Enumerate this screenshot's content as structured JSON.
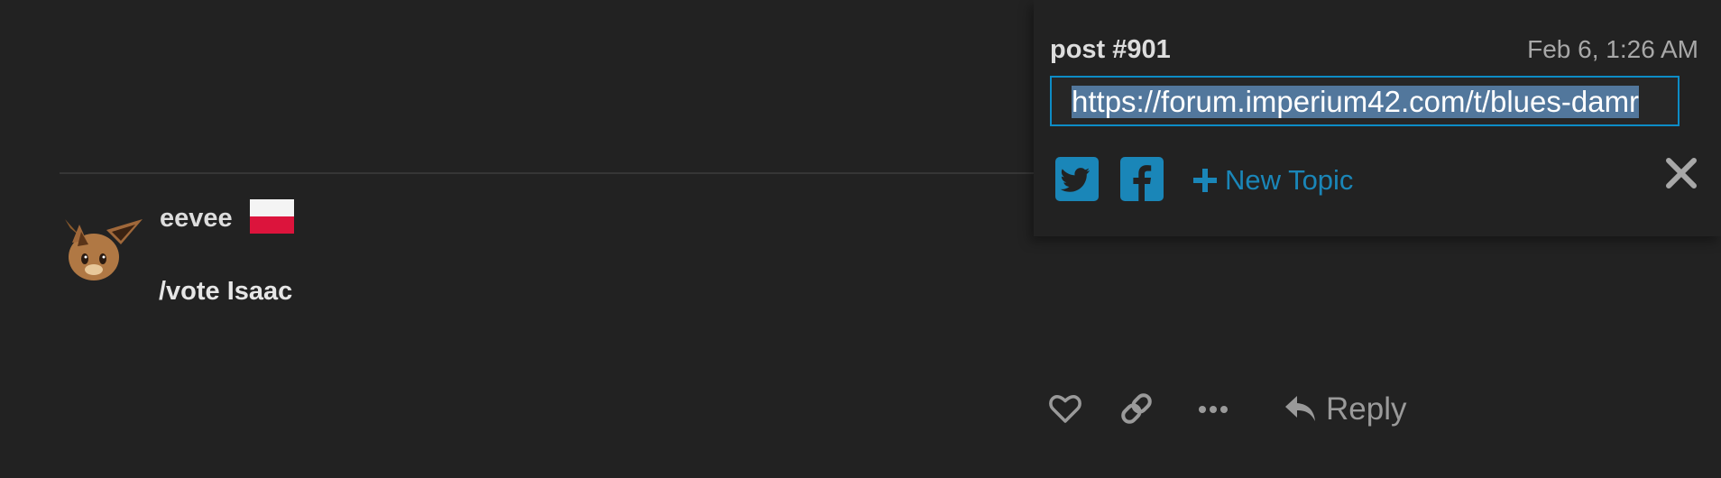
{
  "post": {
    "username": "eevee",
    "body": "/vote Isaac",
    "avatar_icon": "eevee-avatar-icon",
    "flag_icon": "poland-flag-icon"
  },
  "share": {
    "post_number": "post #901",
    "date": "Feb 6, 1:26 AM",
    "url": "https://forum.imperium42.com/t/blues-damr",
    "new_topic_label": "New Topic",
    "twitter_icon": "twitter-icon",
    "facebook_icon": "facebook-icon",
    "close_icon": "close-icon",
    "accent_color": "#1a86b8"
  },
  "actions": {
    "reply_label": "Reply",
    "like_icon": "heart-icon",
    "link_icon": "link-icon",
    "more_icon": "ellipsis-icon",
    "reply_icon": "reply-icon"
  }
}
